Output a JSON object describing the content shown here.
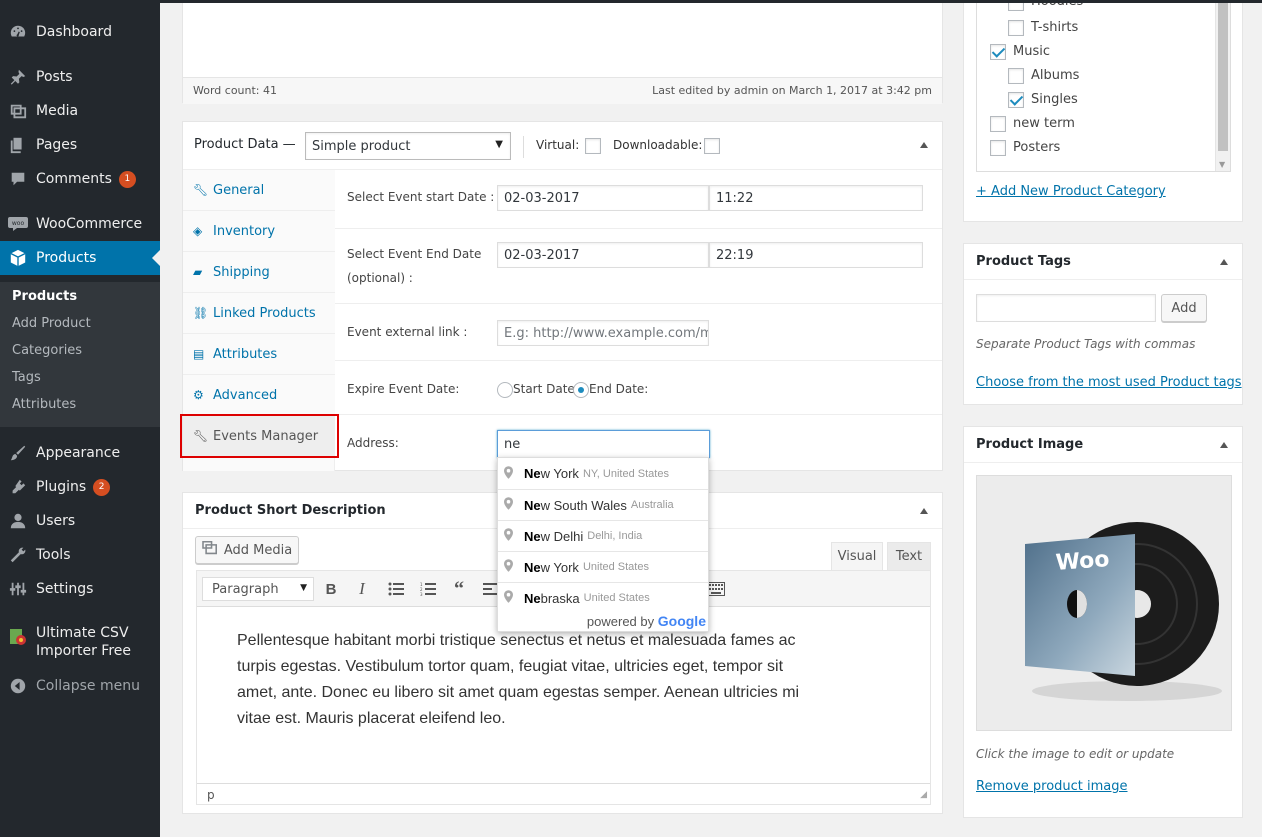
{
  "sidebar": {
    "menu": [
      {
        "label": "Dashboard",
        "icon": "dashboard-icon"
      },
      {
        "label": "Posts",
        "icon": "pin-icon"
      },
      {
        "label": "Media",
        "icon": "media-icon"
      },
      {
        "label": "Pages",
        "icon": "pages-icon"
      },
      {
        "label": "Comments",
        "icon": "comment-icon",
        "badge": "1"
      },
      {
        "label": "WooCommerce",
        "icon": "woo-icon"
      },
      {
        "label": "Products",
        "icon": "products-icon"
      },
      {
        "label": "Appearance",
        "icon": "brush-icon"
      },
      {
        "label": "Plugins",
        "icon": "plugin-icon",
        "badge": "2"
      },
      {
        "label": "Users",
        "icon": "users-icon"
      },
      {
        "label": "Tools",
        "icon": "wrench-icon"
      },
      {
        "label": "Settings",
        "icon": "settings-icon"
      },
      {
        "label": "Ultimate CSV Importer Free",
        "line1": "Ultimate CSV",
        "line2": "Importer Free",
        "icon": "csv-importer-icon"
      },
      {
        "label": "Collapse menu",
        "icon": "collapse-icon"
      }
    ],
    "submenu": [
      "Products",
      "Add Product",
      "Categories",
      "Tags",
      "Attributes"
    ]
  },
  "editor_top": {
    "word_count": "Word count: 41",
    "last_edited": "Last edited by admin on March 1, 2017 at 3:42 pm"
  },
  "product_data": {
    "title": "Product Data —",
    "type_value": "Simple product",
    "virtual_label": "Virtual:",
    "downloadable_label": "Downloadable:",
    "tabs": [
      "General",
      "Inventory",
      "Shipping",
      "Linked Products",
      "Attributes",
      "Advanced",
      "Events Manager"
    ],
    "start_label": "Select Event start Date :",
    "start_date": "02-03-2017",
    "start_time": "11:22",
    "end_label_1": "Select Event End Date",
    "end_label_2": "(optional) :",
    "end_date": "02-03-2017",
    "end_time": "22:19",
    "link_label": "Event external link :",
    "link_placeholder": "E.g: http://www.example.com/my",
    "expire_label": "Expire Event Date:",
    "expire_start": "Start Date:",
    "expire_end": "End Date:",
    "address_label": "Address:",
    "address_value": "ne"
  },
  "autocomplete": {
    "items": [
      {
        "match": "Ne",
        "rest": "w York",
        "secondary": "NY, United States"
      },
      {
        "match": "Ne",
        "rest": "w South Wales",
        "secondary": "Australia"
      },
      {
        "match": "Ne",
        "rest": "w Delhi",
        "secondary": "Delhi, India"
      },
      {
        "match": "Ne",
        "rest": "w York",
        "secondary": "United States"
      },
      {
        "match": "Ne",
        "rest": "braska",
        "secondary": "United States"
      }
    ],
    "powered_by": "powered by",
    "google": "Google"
  },
  "short_description": {
    "title": "Product Short Description",
    "add_media": "Add Media",
    "tab_visual": "Visual",
    "tab_text": "Text",
    "format_value": "Paragraph",
    "content": "Pellentesque habitant morbi tristique senectus et netus et malesuada fames ac turpis egestas. Vestibulum tortor quam, feugiat vitae, ultricies eget, tempor sit amet, ante. Donec eu libero sit amet quam egestas semper. Aenean ultricies mi vitae est. Mauris placerat eleifend leo.",
    "status_path": "p"
  },
  "categories": {
    "items": [
      {
        "label": "Hoodies",
        "checked": false
      },
      {
        "label": "T-shirts",
        "checked": false
      },
      {
        "label": "Music",
        "checked": true
      },
      {
        "label": "Albums",
        "checked": false
      },
      {
        "label": "Singles",
        "checked": true
      },
      {
        "label": "new term",
        "checked": false
      },
      {
        "label": "Posters",
        "checked": false
      }
    ],
    "add_new": "+ Add New Product Category"
  },
  "tags": {
    "title": "Product Tags",
    "add_button": "Add",
    "hint": "Separate Product Tags with commas",
    "choose_link": "Choose from the most used Product tags"
  },
  "product_image": {
    "title": "Product Image",
    "album_text": "Woo",
    "hint": "Click the image to edit or update",
    "remove_link": "Remove product image"
  },
  "colors": {
    "sidebar_bg": "#23282d",
    "active_blue": "#0073aa",
    "highlight_red": "#dd0000"
  }
}
